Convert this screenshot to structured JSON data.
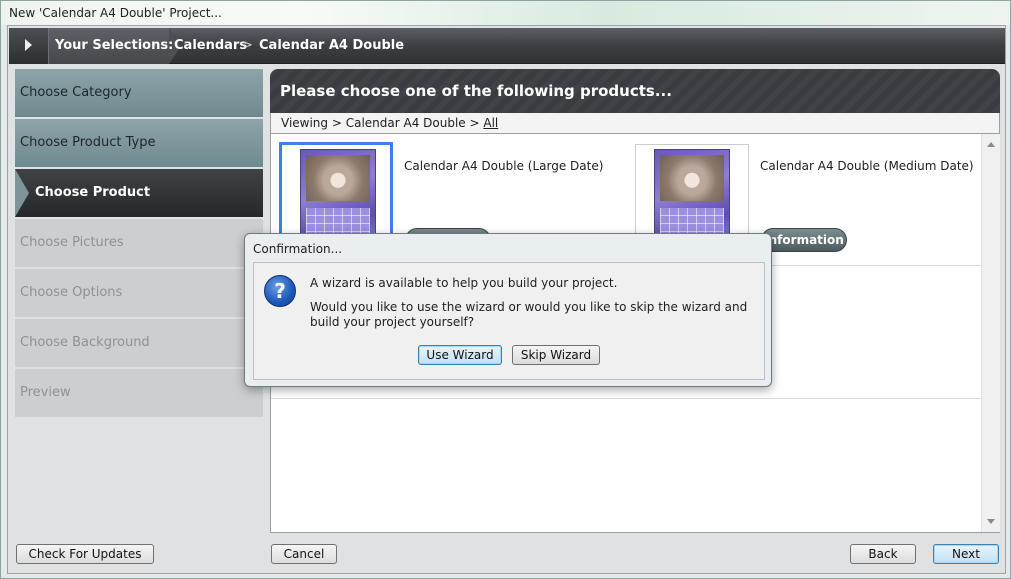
{
  "window": {
    "title": "New 'Calendar A4 Double' Project..."
  },
  "breadcrumb": {
    "label": "Your Selections:",
    "items": [
      "Calendars",
      "Calendar A4 Double"
    ],
    "separator": ">"
  },
  "sidebar": {
    "steps": [
      {
        "label": "Choose Category",
        "state": "done"
      },
      {
        "label": "Choose Product Type",
        "state": "done"
      },
      {
        "label": "Choose Product",
        "state": "active"
      },
      {
        "label": "Choose Pictures",
        "state": "todo"
      },
      {
        "label": "Choose Options",
        "state": "todo"
      },
      {
        "label": "Choose Background",
        "state": "todo"
      },
      {
        "label": "Preview",
        "state": "todo"
      }
    ]
  },
  "main": {
    "header": "Please choose one of the following products...",
    "viewing": {
      "prefix": "Viewing > Calendar A4 Double > ",
      "all_link": "All"
    },
    "products": [
      {
        "name": "Calendar A4 Double (Large Date)",
        "info_label": "Information",
        "selected": true
      },
      {
        "name": "Calendar A4 Double (Medium Date)",
        "info_label": "Information",
        "selected": false
      }
    ]
  },
  "footer": {
    "check_updates": "Check For Updates",
    "cancel": "Cancel",
    "back": "Back",
    "next": "Next"
  },
  "dialog": {
    "title": "Confirmation...",
    "line1": "A wizard is available to help you build your project.",
    "line2": "Would you like to use the wizard or would you like to skip the wizard and build your project yourself?",
    "use_wizard": "Use Wizard",
    "skip_wizard": "Skip Wizard",
    "icon": "question-icon"
  },
  "colors": {
    "accent_selection": "#3d7ee8",
    "dark_header": "#3c3f43",
    "done_step": "#7d9598"
  }
}
